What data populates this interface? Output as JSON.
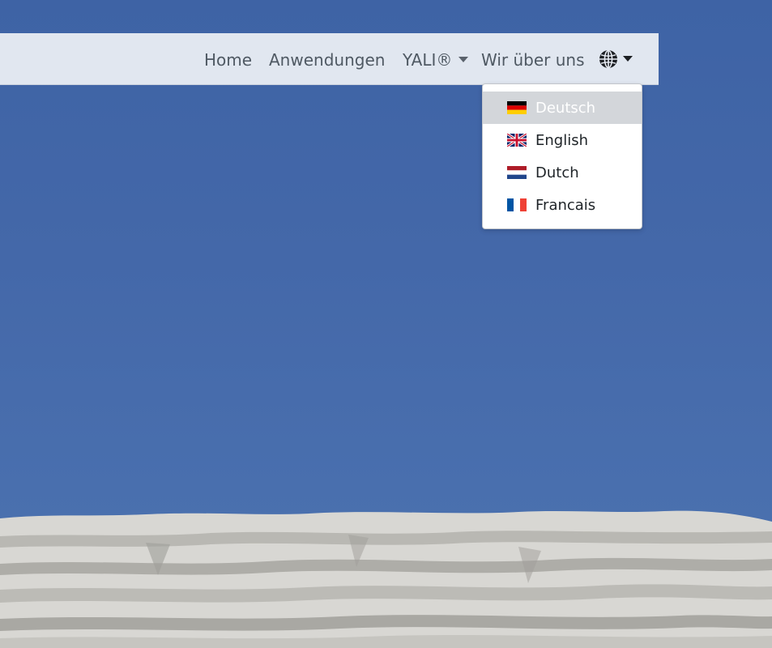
{
  "navbar": {
    "home": "Home",
    "apps": "Anwendungen",
    "yali": "YALI®",
    "about": "Wir über uns",
    "language_icon": "globe-icon"
  },
  "language_menu": {
    "items": [
      {
        "label": "Deutsch",
        "flag": "flag-germany-icon",
        "active": true
      },
      {
        "label": "English",
        "flag": "flag-uk-icon",
        "active": false
      },
      {
        "label": "Dutch",
        "flag": "flag-netherlands-icon",
        "active": false
      },
      {
        "label": "Francais",
        "flag": "flag-france-icon",
        "active": false
      }
    ]
  },
  "colors": {
    "sky": "#4468a8",
    "navbar_bg": "#e8ecf3",
    "nav_text": "#4f5963",
    "active_item_bg": "#d3d6da"
  }
}
